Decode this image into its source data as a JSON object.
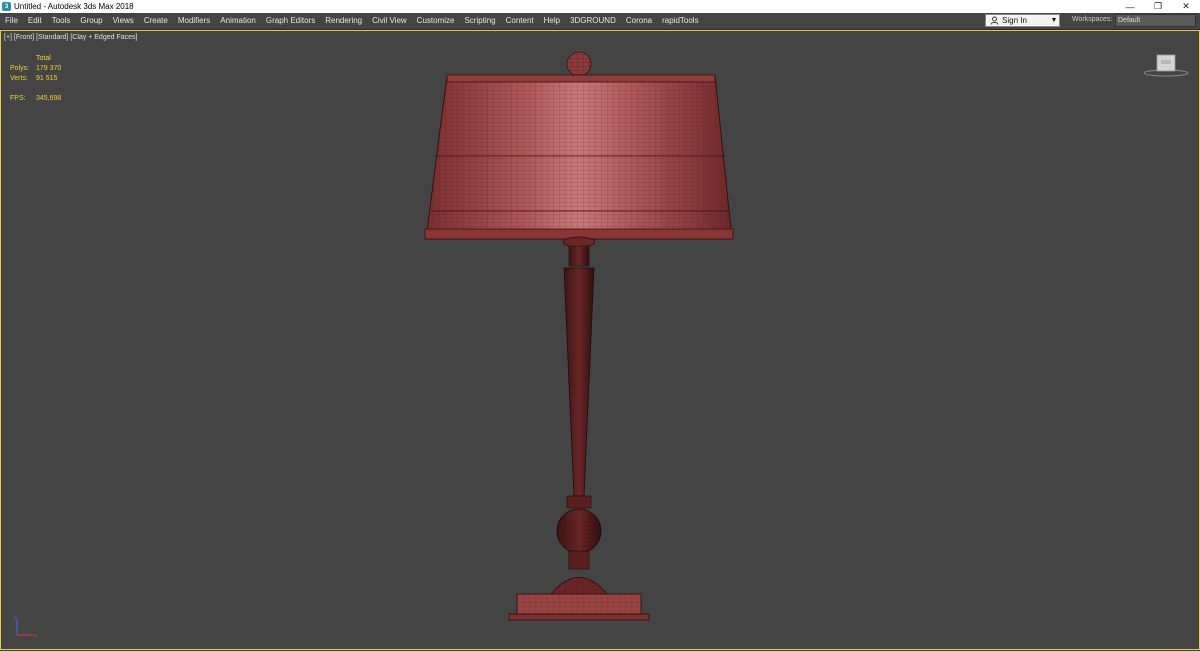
{
  "window": {
    "title": "Untitled - Autodesk 3ds Max 2018",
    "icon": "3ds-max-app-icon",
    "controls": {
      "minimize": "—",
      "restore": "❐",
      "close": "✕"
    }
  },
  "menubar": {
    "items": [
      "File",
      "Edit",
      "Tools",
      "Group",
      "Views",
      "Create",
      "Modifiers",
      "Animation",
      "Graph Editors",
      "Rendering",
      "Civil View",
      "Customize",
      "Scripting",
      "Content",
      "Help",
      "3DGROUND",
      "Corona",
      "rapidTools"
    ],
    "sign_in": "Sign In",
    "workspaces_label": "Workspaces:",
    "workspace_value": "Default"
  },
  "viewport": {
    "label": "[+] [Front] [Standard] [Clay + Edged Faces]",
    "stats": {
      "header": "Total",
      "polys_label": "Polys:",
      "polys_value": "179 370",
      "verts_label": "Verts:",
      "verts_value": "91 515",
      "fps_label": "FPS:",
      "fps_value": "345,698"
    },
    "accent": "#e8c84a",
    "background": "#444444",
    "model_color": "#9a4848"
  }
}
